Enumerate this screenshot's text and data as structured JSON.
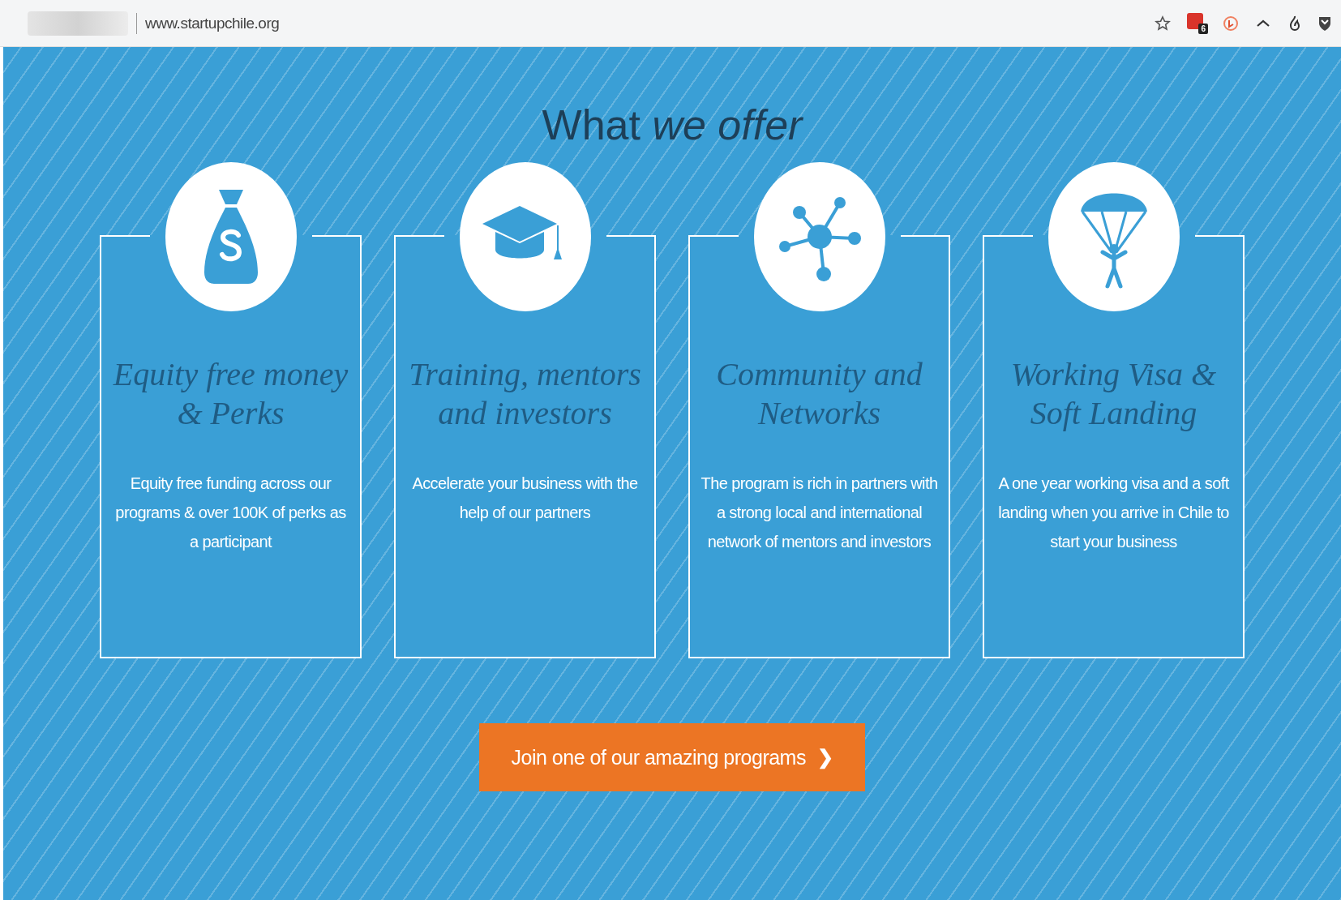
{
  "browser": {
    "url": "www.startupchile.org",
    "extension_badge": "6"
  },
  "section": {
    "title": "What *we offer*",
    "cards": [
      {
        "kind": "money",
        "heading": "Equity free money & Perks",
        "text": "Equity free funding across our programs & over 100K of perks as a participant"
      },
      {
        "kind": "education",
        "heading": "Training, mentors and investors",
        "text": "Accelerate your business with the help of our partners"
      },
      {
        "kind": "network",
        "heading": "Community and Networks",
        "text": "The program is rich in partners with a strong local and international network of mentors and investors"
      },
      {
        "kind": "parachute",
        "heading": "Working Visa & Soft Landing",
        "text": "A one year working visa and a soft landing when you arrive in Chile to start your business"
      }
    ],
    "cta": {
      "label": "Join one of our amazing programs",
      "icon": "❯"
    }
  }
}
